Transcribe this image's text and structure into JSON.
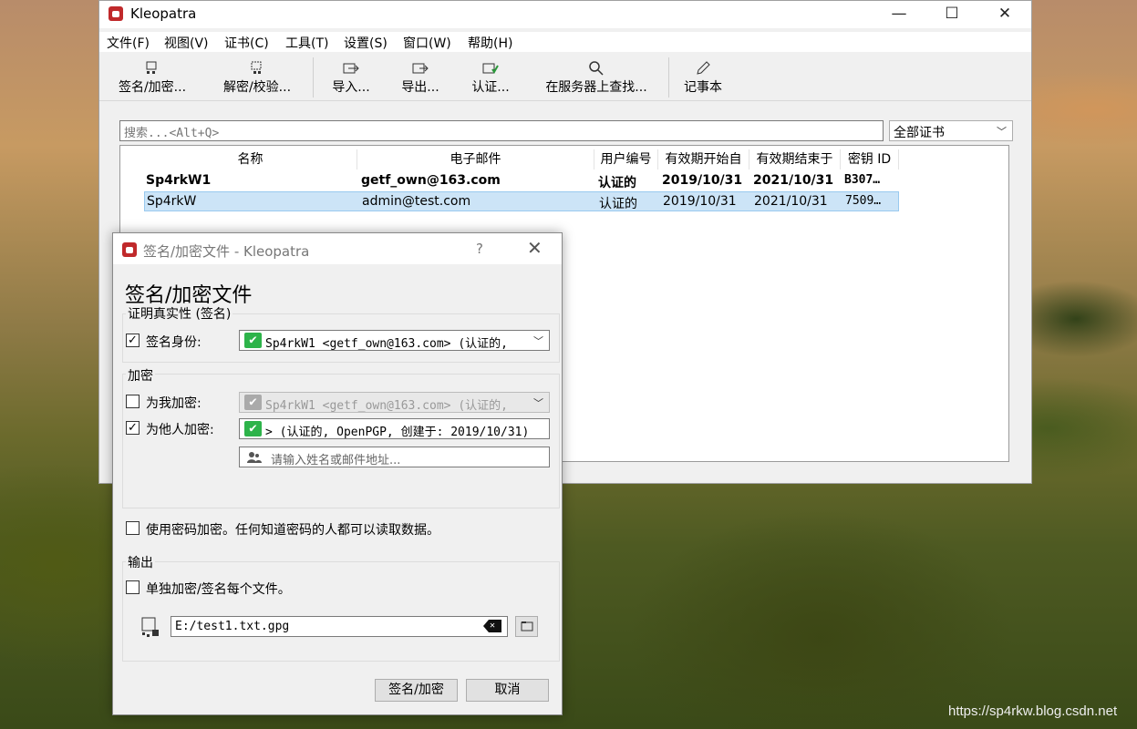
{
  "main_window": {
    "title": "Kleopatra",
    "controls": {
      "minimize": "—",
      "maximize": "☐",
      "close": "✕"
    },
    "menu": [
      "文件(F)",
      "视图(V)",
      "证书(C)",
      "工具(T)",
      "设置(S)",
      "窗口(W)",
      "帮助(H)"
    ],
    "toolbar": [
      "签名/加密...",
      "解密/校验...",
      "导入...",
      "导出...",
      "认证...",
      "在服务器上查找...",
      "记事本"
    ],
    "search": {
      "placeholder": "搜索...<Alt+Q>"
    },
    "filter": {
      "selected": "全部证书"
    },
    "columns": [
      "名称",
      "电子邮件",
      "用户编号",
      "有效期开始自",
      "有效期结束于",
      "密钥 ID"
    ],
    "rows": [
      {
        "name": "Sp4rkW1",
        "email": "getf_own@163.com",
        "user_id": "认证的",
        "valid_from": "2019/10/31",
        "valid_until": "2021/10/31",
        "key_id": "B307…"
      },
      {
        "name": "Sp4rkW",
        "email": "admin@test.com",
        "user_id": "认证的",
        "valid_from": "2019/10/31",
        "valid_until": "2021/10/31",
        "key_id": "7509…"
      }
    ]
  },
  "dialog": {
    "title": "签名/加密文件 - Kleopatra",
    "help": "?",
    "close": "✕",
    "heading": "签名/加密文件",
    "auth_group": "证明真实性 (签名)",
    "sign_as_label": "签名身份:",
    "sign_as_value": "Sp4rkW1 <getf_own@163.com> (认证的, ",
    "encrypt_group": "加密",
    "encrypt_me_label": "为我加密:",
    "encrypt_me_value": "Sp4rkW1 <getf_own@163.com> (认证的, ",
    "encrypt_others_label": "为他人加密:",
    "encrypt_others_value": "> (认证的, OpenPGP, 创建于: 2019/10/31)",
    "recipient_placeholder": "请输入姓名或邮件地址...",
    "password_label": "使用密码加密。任何知道密码的人都可以读取数据。",
    "output_group": "输出",
    "separate_label": "单独加密/签名每个文件。",
    "output_path": "E:/test1.txt.gpg",
    "sign_encrypt_button": "签名/加密",
    "cancel_button": "取消",
    "checks": {
      "sign_as": true,
      "encrypt_me": false,
      "encrypt_others": true,
      "password": false,
      "separate": false
    }
  },
  "watermark": "https://sp4rkw.blog.csdn.net"
}
